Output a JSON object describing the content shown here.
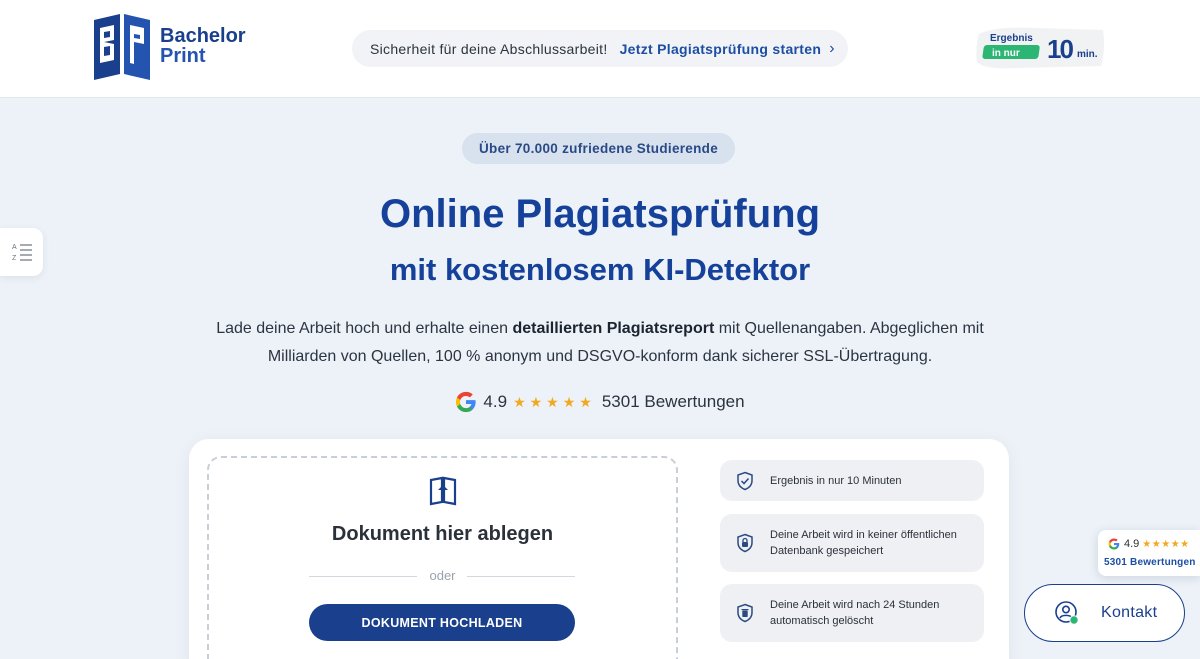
{
  "header": {
    "brand_line1": "Bachelor",
    "brand_line2": "Print",
    "announcement_text": "Sicherheit für deine Abschlussarbeit!",
    "announcement_cta": "Jetzt Plagiatsprüfung starten",
    "badge_line1": "Ergebnis",
    "badge_line2": "in nur",
    "badge_number": "10",
    "badge_unit": "min."
  },
  "hero": {
    "pill": "Über 70.000 zufriedene Studierende",
    "title": "Online Plagiatsprüfung",
    "subtitle": "mit kostenlosem KI-Detektor",
    "desc_part1": "Lade deine Arbeit hoch und erhalte einen ",
    "desc_bold": "detaillierten Plagiatsreport",
    "desc_part2": " mit Quellenangaben. Abgeglichen mit Milliarden von Quellen, 100 % anonym und DSGVO-konform dank sicherer SSL-Übertragung.",
    "rating_score": "4.9",
    "rating_stars": "★★★★★",
    "rating_count": "5301 Bewertungen"
  },
  "upload": {
    "title": "Dokument hier ablegen",
    "or": "oder",
    "button": "DOKUMENT HOCHLADEN"
  },
  "features": [
    {
      "icon": "shield-check-icon",
      "text": "Ergebnis in nur 10 Minuten"
    },
    {
      "icon": "lock-icon",
      "text": "Deine Arbeit wird in keiner öffentlichen Datenbank gespeichert"
    },
    {
      "icon": "trash-icon",
      "text": "Deine Arbeit wird nach 24 Stunden automatisch gelöscht"
    }
  ],
  "google_widget": {
    "score": "4.9",
    "stars": "★★★★★",
    "count": "5301 Bewertungen"
  },
  "contact": {
    "label": "Kontakt"
  },
  "colors": {
    "brand_blue": "#1a3f8c",
    "star_gold": "#f2a81f",
    "badge_green": "#2bb673",
    "page_bg": "#edf2f8"
  }
}
